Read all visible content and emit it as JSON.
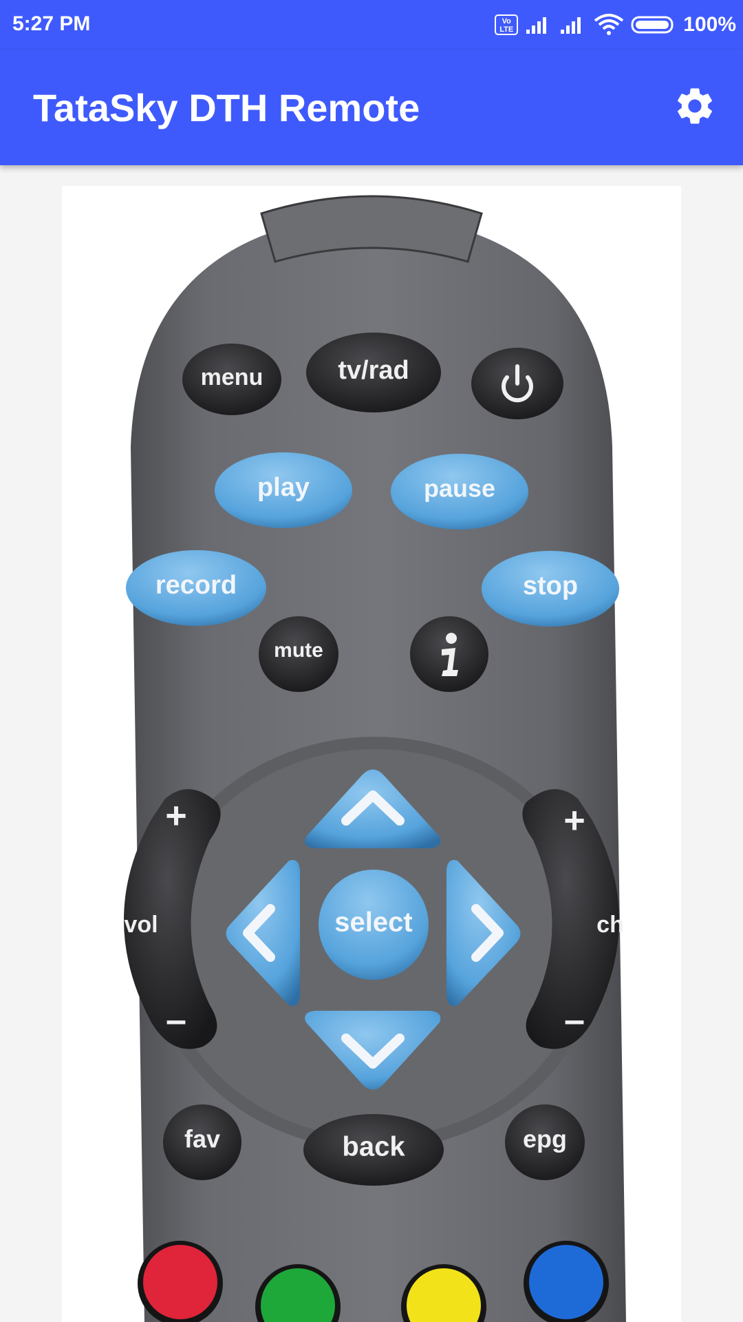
{
  "status": {
    "time": "5:27 PM",
    "volte": "Vo LTE",
    "battery": "100%"
  },
  "app": {
    "title": "TataSky DTH Remote",
    "settings_icon": "gear-icon"
  },
  "remote": {
    "top_row": {
      "menu": "menu",
      "tvrad": "tv/rad"
    },
    "playback": {
      "play": "play",
      "pause": "pause",
      "record": "record",
      "stop": "stop"
    },
    "mid_row": {
      "mute": "mute",
      "info_icon": "info-icon"
    },
    "dpad": {
      "select": "select"
    },
    "vol": {
      "label": "vol",
      "plus": "+",
      "minus": "–"
    },
    "ch": {
      "label": "ch",
      "plus": "+",
      "minus": "–"
    },
    "bottom_row": {
      "fav": "fav",
      "back": "back",
      "epg": "epg"
    },
    "colors": {
      "red": "#e0243a",
      "green": "#1ea83a",
      "yellow": "#f2e21a",
      "blue": "#1e6bd8"
    }
  }
}
